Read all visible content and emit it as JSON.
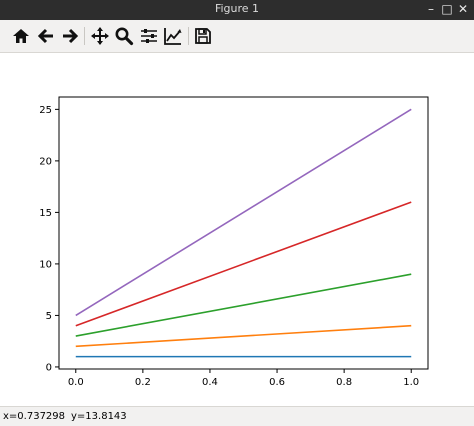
{
  "window": {
    "title": "Figure 1",
    "controls": {
      "minimize": "–",
      "maximize": "□",
      "close": "✕"
    }
  },
  "toolbar": {
    "buttons": [
      {
        "name": "home-button",
        "icon": "home-icon"
      },
      {
        "name": "back-button",
        "icon": "arrow-left-icon"
      },
      {
        "name": "forward-button",
        "icon": "arrow-right-icon"
      },
      {
        "name": "pan-button",
        "icon": "move-icon"
      },
      {
        "name": "zoom-button",
        "icon": "zoom-icon"
      },
      {
        "name": "subplots-button",
        "icon": "sliders-icon"
      },
      {
        "name": "edit-axes-button",
        "icon": "chart-line-icon"
      },
      {
        "name": "save-button",
        "icon": "floppy-disk-icon"
      }
    ]
  },
  "status": {
    "x_readout": "x=0.737298",
    "y_readout": "y=13.8143"
  },
  "chart_data": {
    "type": "line",
    "x": [
      0.0,
      1.0
    ],
    "series": [
      {
        "values": [
          1,
          1
        ],
        "color": "#1f77b4"
      },
      {
        "values": [
          2,
          4
        ],
        "color": "#ff7f0e"
      },
      {
        "values": [
          3,
          9
        ],
        "color": "#2ca02c"
      },
      {
        "values": [
          4,
          16
        ],
        "color": "#d62728"
      },
      {
        "values": [
          5,
          25
        ],
        "color": "#9467bd"
      }
    ],
    "xlim": [
      -0.05,
      1.05
    ],
    "ylim": [
      -0.2,
      26.2
    ],
    "xticks": [
      0.0,
      0.2,
      0.4,
      0.6,
      0.8,
      1.0
    ],
    "xtick_labels": [
      "0.0",
      "0.2",
      "0.4",
      "0.6",
      "0.8",
      "1.0"
    ],
    "yticks": [
      0,
      5,
      10,
      15,
      20,
      25
    ],
    "ytick_labels": [
      "0",
      "5",
      "10",
      "15",
      "20",
      "25"
    ],
    "grid": false,
    "legend": "none",
    "title": "",
    "xlabel": "",
    "ylabel": ""
  }
}
